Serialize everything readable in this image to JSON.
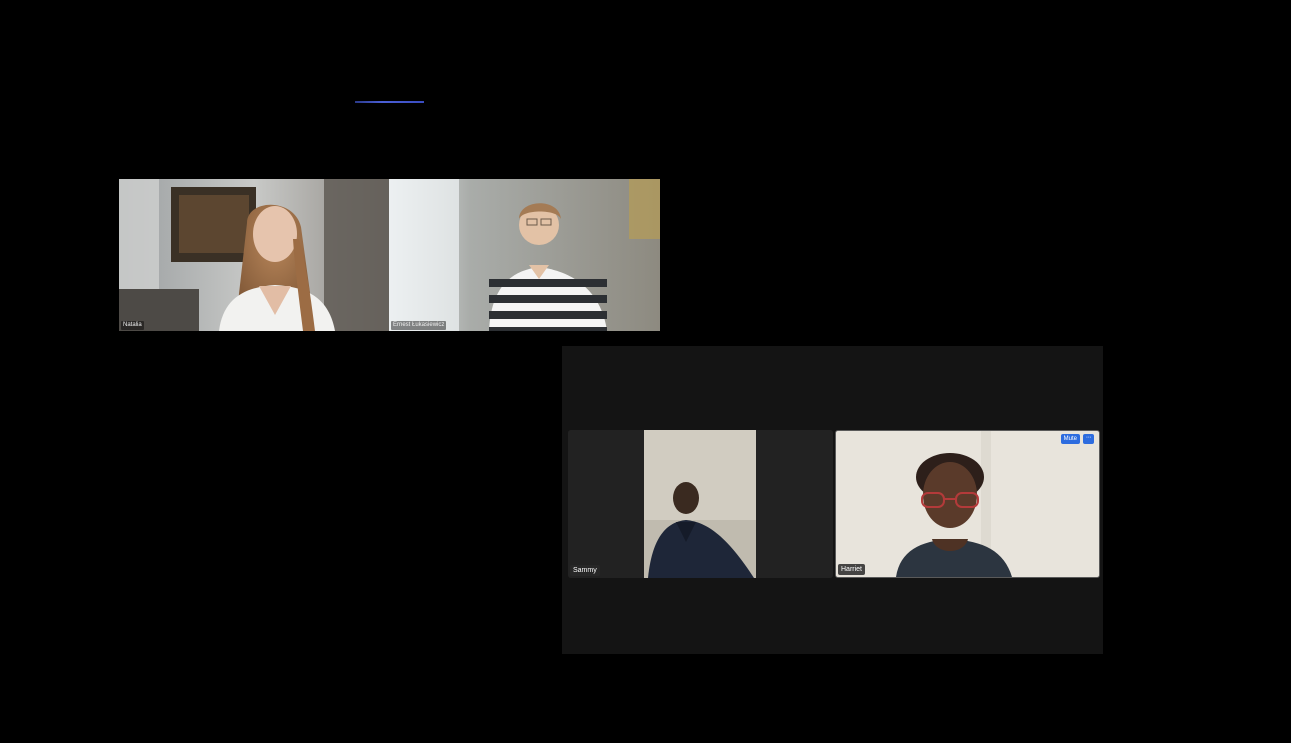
{
  "meeting_top": {
    "participants": [
      {
        "name": "Natalia",
        "icon": "video-feed"
      },
      {
        "name": "Ernest Łukasiewicz",
        "icon": "video-feed"
      }
    ]
  },
  "meeting_bottom": {
    "participants": [
      {
        "name": "Sammy",
        "icon": "video-feed"
      },
      {
        "name": "Harriet",
        "icon": "video-feed"
      }
    ],
    "hover_controls": {
      "mute_label": "Mute",
      "more_label": "···"
    }
  },
  "colors": {
    "background": "#000000",
    "panel": "#141414",
    "tile_bg": "#222222",
    "accent": "#2d6cdf"
  }
}
